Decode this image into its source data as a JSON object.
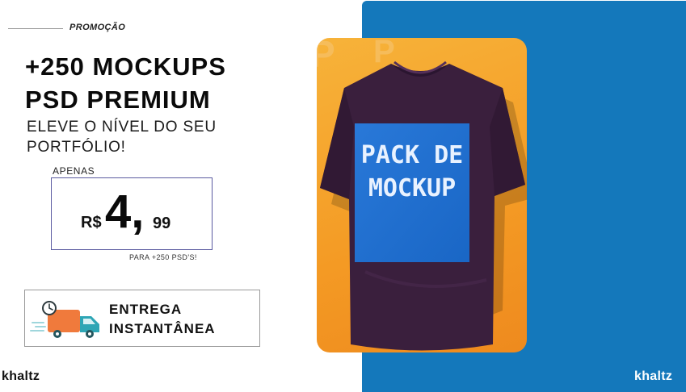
{
  "promo": {
    "label": "PROMOÇÃO"
  },
  "headline": {
    "line1": "+250 MOCKUPS",
    "line2": "PSD PREMIUM"
  },
  "subheadline": {
    "line1": "ELEVE O NÍVEL DO SEU",
    "line2": "PORTFÓLIO!"
  },
  "price": {
    "prefix": "APENAS",
    "currency": "R$",
    "integer": "4,",
    "cents": "99",
    "note": "PARA +250 PSD'S!"
  },
  "delivery": {
    "line1": "ENTREGA",
    "line2": "INSTANTÂNEA",
    "icon": "delivery-truck-icon"
  },
  "brand": {
    "left": "khaltz",
    "right": "khaltz"
  },
  "product": {
    "shirt_text_line1": "PACK DE",
    "shirt_text_line2": "MOCKUP",
    "background_letters": "P P"
  },
  "colors": {
    "accent_blue": "#1478bb",
    "card_orange": "#f49a24",
    "shirt_purple": "#3a1f3d",
    "print_blue": "#1f6fd1",
    "truck_orange": "#f07a3c",
    "truck_teal": "#2ea6b5"
  }
}
